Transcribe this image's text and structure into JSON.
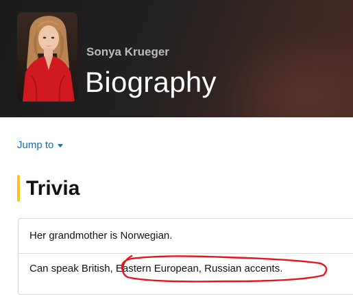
{
  "header": {
    "name": "Sonya Krueger",
    "title": "Biography",
    "portrait_icon": "person-portrait"
  },
  "nav": {
    "jump_label": "Jump to"
  },
  "section": {
    "title": "Trivia",
    "accent_color": "#f5c518"
  },
  "trivia": {
    "items": [
      "Her grandmother is Norwegian.",
      "Can speak British, Eastern European, Russian accents."
    ]
  },
  "colors": {
    "link": "#136cb2",
    "annotation": "#e8141b"
  }
}
